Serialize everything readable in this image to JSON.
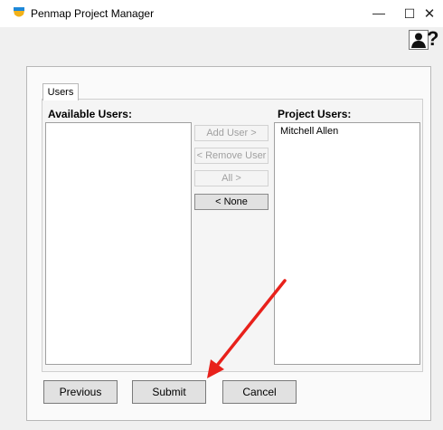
{
  "window": {
    "title": "Penmap Project Manager",
    "minimize_glyph": "—",
    "maximize_glyph": "☐",
    "close_glyph": "✕",
    "icon": "penmap-shield-icon"
  },
  "toolbar": {
    "user_icon": "user-icon",
    "help_glyph": "?"
  },
  "tabs": [
    {
      "label": "Users",
      "selected": true
    }
  ],
  "users_tab": {
    "available_label": "Available Users:",
    "project_label": "Project Users:",
    "available_users": [],
    "project_users": [
      "Mitchell Allen"
    ],
    "add_user_label": "Add User >",
    "remove_user_label": "< Remove User",
    "all_label": "All >",
    "none_label": "< None"
  },
  "footer": {
    "previous_label": "Previous",
    "submit_label": "Submit",
    "cancel_label": "Cancel"
  },
  "annotation": {
    "arrow_color": "#e8211b"
  },
  "colors": {
    "icon_blue": "#1e88d8",
    "icon_yellow": "#f2b21a"
  }
}
